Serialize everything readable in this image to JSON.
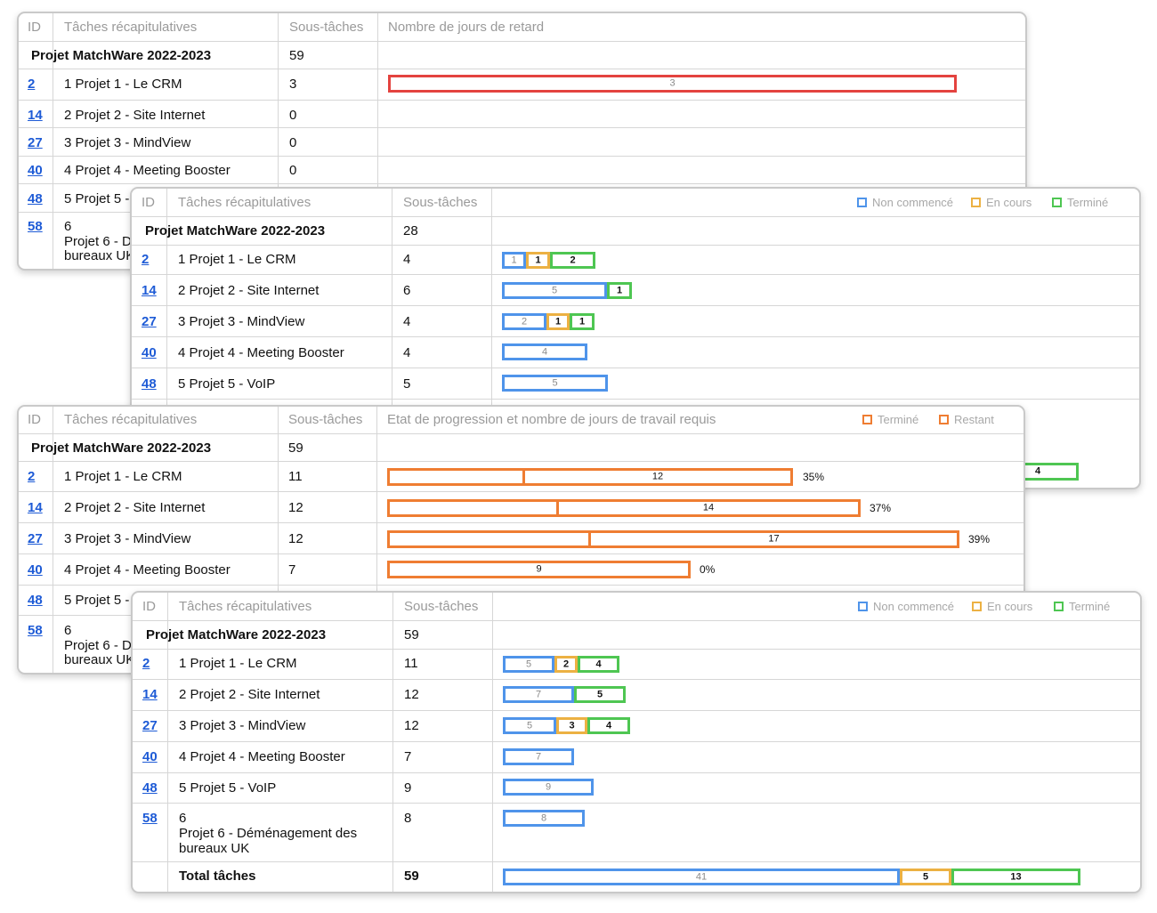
{
  "headers": {
    "id": "ID",
    "summary": "Tâches récapitulatives",
    "subtasks": "Sous-tâches",
    "delay": "Nombre de jours de retard",
    "progress": "Etat de progression et nombre de jours de travail requis"
  },
  "project_name": "Projet MatchWare 2022-2023",
  "legend": {
    "not_started": "Non commencé",
    "in_progress": "En cours",
    "done": "Terminé",
    "remaining": "Restant"
  },
  "colors": {
    "blue": "#4f94ea",
    "yellow": "#ecb143",
    "green": "#4ec652",
    "red": "#e4433f",
    "orange": "#ef7d32",
    "link": "#1e5bd6"
  },
  "panel1": {
    "total": "59",
    "rows": [
      {
        "id": "2",
        "name": "1 Projet 1 - Le CRM",
        "sub": "3",
        "delay": "3"
      },
      {
        "id": "14",
        "name": "2 Projet 2 - Site Internet",
        "sub": "0"
      },
      {
        "id": "27",
        "name": "3 Projet 3 - MindView",
        "sub": "0"
      },
      {
        "id": "40",
        "name": "4 Projet 4 - Meeting Booster",
        "sub": "0"
      },
      {
        "id": "48",
        "name": "5 Projet 5 -"
      },
      {
        "id": "58",
        "name_a": "6",
        "name_b": "Projet 6 - D",
        "name_c": "bureaux UK"
      }
    ]
  },
  "panel2": {
    "total": "28",
    "rows": [
      {
        "id": "2",
        "name": "1 Projet 1 - Le CRM",
        "sub": "4",
        "bars": [
          {
            "c": "blue",
            "v": "1"
          },
          {
            "c": "yellow",
            "v": "1"
          },
          {
            "c": "green",
            "v": "2"
          }
        ]
      },
      {
        "id": "14",
        "name": "2 Projet 2 - Site Internet",
        "sub": "6",
        "bars": [
          {
            "c": "blue",
            "v": "5"
          },
          {
            "c": "green",
            "v": "1"
          }
        ]
      },
      {
        "id": "27",
        "name": "3 Projet 3 - MindView",
        "sub": "4",
        "bars": [
          {
            "c": "blue",
            "v": "2"
          },
          {
            "c": "yellow",
            "v": "1"
          },
          {
            "c": "green",
            "v": "1"
          }
        ]
      },
      {
        "id": "40",
        "name": "4 Projet 4 - Meeting Booster",
        "sub": "4",
        "bars": [
          {
            "c": "blue",
            "v": "4"
          }
        ]
      },
      {
        "id": "48",
        "name": "5 Projet 5 - VoIP",
        "sub": "5",
        "bars": [
          {
            "c": "blue",
            "v": "5"
          }
        ]
      }
    ],
    "partial_bar": "4"
  },
  "panel3": {
    "total": "59",
    "rows": [
      {
        "id": "2",
        "name": "1 Projet 1 - Le CRM",
        "sub": "11",
        "remaining": "12",
        "pct": "35%"
      },
      {
        "id": "14",
        "name": "2 Projet 2 - Site Internet",
        "sub": "12",
        "remaining": "14",
        "pct": "37%"
      },
      {
        "id": "27",
        "name": "3 Projet 3 - MindView",
        "sub": "12",
        "remaining": "17",
        "pct": "39%"
      },
      {
        "id": "40",
        "name": "4 Projet 4 - Meeting Booster",
        "sub": "7",
        "remaining": "9",
        "pct": "0%"
      },
      {
        "id": "48",
        "name": "5 Projet 5 -"
      },
      {
        "id": "58",
        "name_a": "6",
        "name_b": "Projet 6 - D",
        "name_c": "bureaux UK"
      }
    ]
  },
  "panel4": {
    "total": "59",
    "rows": [
      {
        "id": "2",
        "name": "1 Projet 1 - Le CRM",
        "sub": "11",
        "bars": [
          {
            "c": "blue",
            "v": "5"
          },
          {
            "c": "yellow",
            "v": "2"
          },
          {
            "c": "green",
            "v": "4"
          }
        ]
      },
      {
        "id": "14",
        "name": "2 Projet 2 - Site Internet",
        "sub": "12",
        "bars": [
          {
            "c": "blue",
            "v": "7"
          },
          {
            "c": "green",
            "v": "5"
          }
        ]
      },
      {
        "id": "27",
        "name": "3 Projet 3 - MindView",
        "sub": "12",
        "bars": [
          {
            "c": "blue",
            "v": "5"
          },
          {
            "c": "yellow",
            "v": "3"
          },
          {
            "c": "green",
            "v": "4"
          }
        ]
      },
      {
        "id": "40",
        "name": "4 Projet 4 - Meeting Booster",
        "sub": "7",
        "bars": [
          {
            "c": "blue",
            "v": "7"
          }
        ]
      },
      {
        "id": "48",
        "name": "5 Projet 5 - VoIP",
        "sub": "9",
        "bars": [
          {
            "c": "blue",
            "v": "9"
          }
        ]
      },
      {
        "id": "58",
        "name_a": "6",
        "name_b": "Projet 6 - Déménagement des",
        "name_c": "bureaux UK",
        "sub": "8",
        "bars": [
          {
            "c": "blue",
            "v": "8"
          }
        ]
      }
    ],
    "total_label": "Total tâches",
    "total_value": "59",
    "total_bars": [
      {
        "c": "blue",
        "v": "41"
      },
      {
        "c": "yellow",
        "v": "5"
      },
      {
        "c": "green",
        "v": "13"
      }
    ]
  }
}
